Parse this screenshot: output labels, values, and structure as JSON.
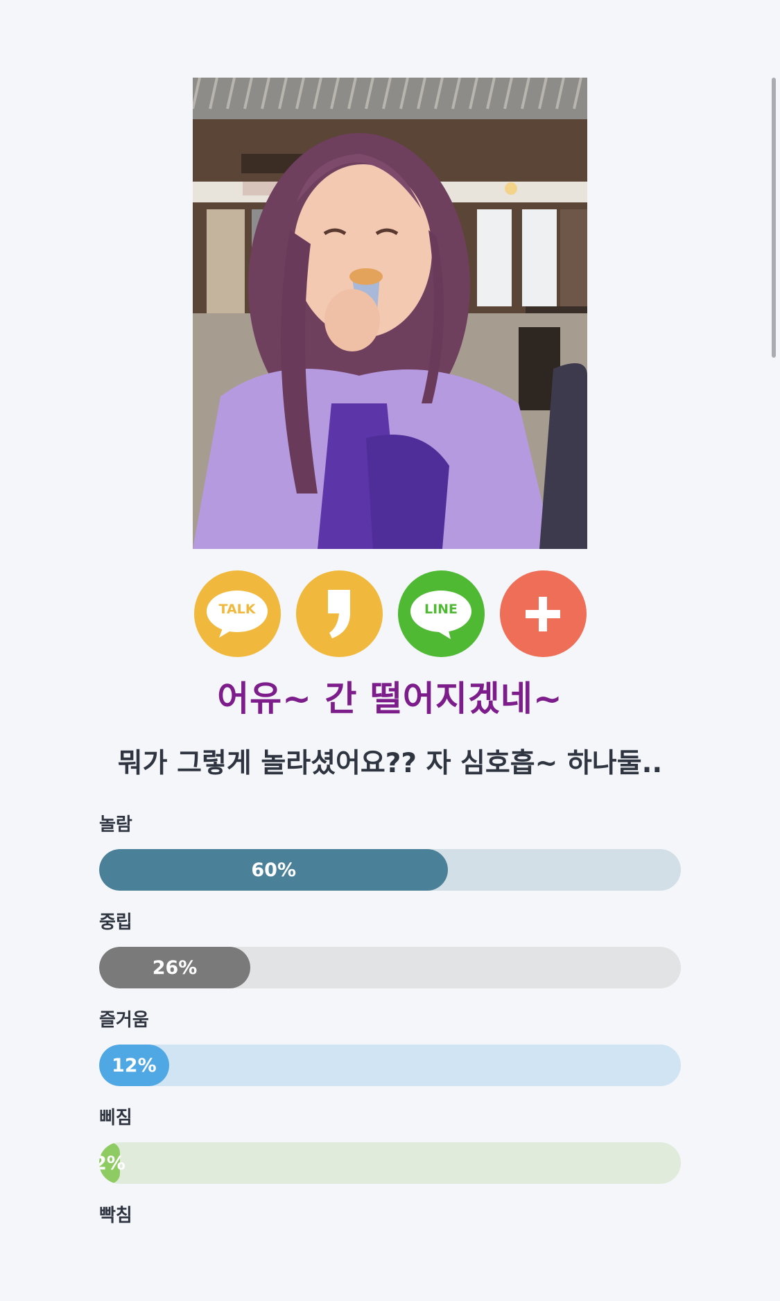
{
  "share": {
    "buttons": [
      {
        "name": "kakaotalk-share",
        "label": "TALK",
        "color": "#f0b93d"
      },
      {
        "name": "kakaostory-share",
        "label": "",
        "color": "#f0b93d"
      },
      {
        "name": "line-share",
        "label": "LINE",
        "color": "#4fb934"
      },
      {
        "name": "more-share",
        "label": "",
        "color": "#ee6e58"
      }
    ]
  },
  "result": {
    "headline": "어유~ 간 떨어지겠네~",
    "subline": "뭐가 그렇게 놀라셨어요?? 자 심호흡~ 하나둘.."
  },
  "emotions": [
    {
      "label": "놀람",
      "percent": 60,
      "value_text": "60%",
      "fill_color": "#4a8098",
      "track_color": "#d2dfe7"
    },
    {
      "label": "중립",
      "percent": 26,
      "value_text": "26%",
      "fill_color": "#7a7a7a",
      "track_color": "#e2e3e5"
    },
    {
      "label": "즐거움",
      "percent": 12,
      "value_text": "12%",
      "fill_color": "#4fa8e4",
      "track_color": "#d0e4f3"
    },
    {
      "label": "삐짐",
      "percent": 2,
      "value_text": "2%",
      "fill_color": "#8fcb63",
      "track_color": "#e0ebdb"
    },
    {
      "label": "빡침",
      "percent": 0,
      "value_text": "",
      "fill_color": "#e57373",
      "track_color": "#f0dede"
    }
  ]
}
